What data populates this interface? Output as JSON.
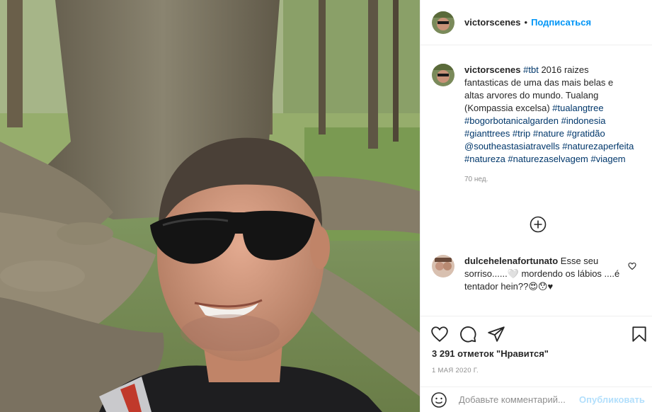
{
  "post": {
    "photo_alt": "selfie with sunglasses in front of a giant tree with buttress roots"
  },
  "header": {
    "username": "victorscenes",
    "separator": "•",
    "follow_label": "Подписаться"
  },
  "caption": {
    "username": "victorscenes",
    "hashtag_tbt": "#tbt",
    "text": " 2016 raizes fantasticas de uma das mais belas e altas arvores do mundo. Tualang (Kompassia excelsa) ",
    "tags_1": "#tualangtree #bogorbotanicalgarden #indonesia #gianttrees #trip #nature #gratidão @southeastasiatravells #naturezaperfeita #natureza #naturezaselvagem #viagem",
    "time": "70 нед."
  },
  "comment": {
    "username": "dulcehelenafortunato",
    "text": " Esse seu sorriso......🤍 mordendo os lábios ....é tentador hein??😍😯♥"
  },
  "actions": {
    "likes": "3 291 отметок \"Нравится\"",
    "date": "1 МАЯ 2020 Г."
  },
  "add_comment": {
    "placeholder": "Добавьте комментарий...",
    "publish_label": "Опубликовать"
  },
  "colors": {
    "accent": "#0095f6",
    "hashtag": "#00376b",
    "muted": "#8e8e8e"
  }
}
